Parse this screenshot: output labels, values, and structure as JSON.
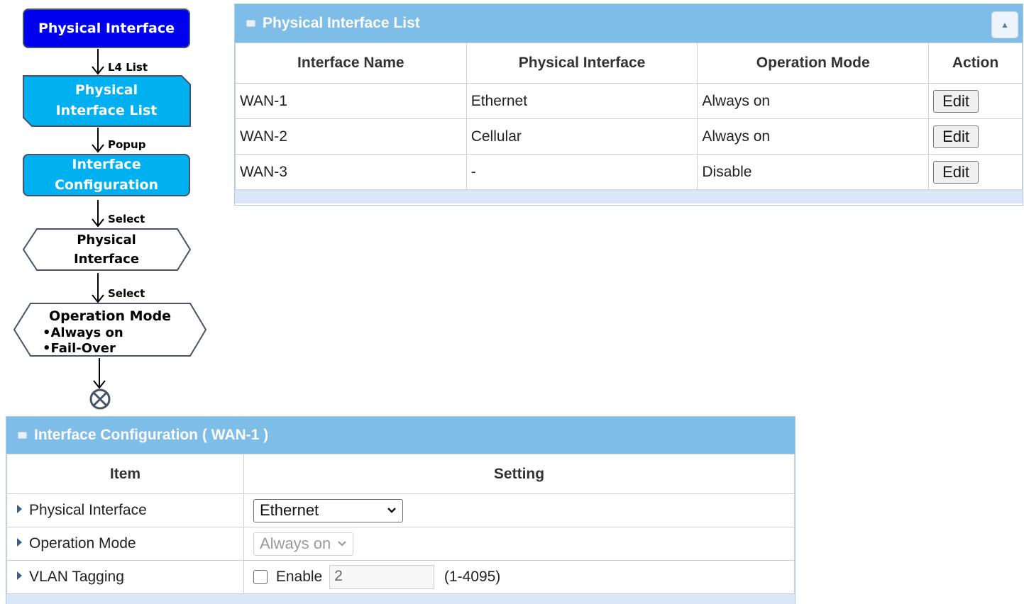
{
  "flowchart": {
    "step1": "Physical Interface",
    "label1": "L4 List",
    "step2_line1": "Physical",
    "step2_line2": "Interface List",
    "label2": "Popup",
    "step3_line1": "Interface",
    "step3_line2": "Configuration",
    "label3": "Select",
    "step4_line1": "Physical",
    "step4_line2": "Interface",
    "label4": "Select",
    "step5_title": "Operation Mode",
    "step5_opt1": "•Always on",
    "step5_opt2": "•Fail-Over",
    "colors": {
      "dark": "#0000ee",
      "light": "#00b0f0",
      "border": "#44546a"
    }
  },
  "interface_list": {
    "title": "Physical Interface List",
    "columns": [
      "Interface Name",
      "Physical Interface",
      "Operation Mode",
      "Action"
    ],
    "rows": [
      {
        "name": "WAN-1",
        "physical": "Ethernet",
        "mode": "Always on",
        "action": "Edit"
      },
      {
        "name": "WAN-2",
        "physical": "Cellular",
        "mode": "Always on",
        "action": "Edit"
      },
      {
        "name": "WAN-3",
        "physical": "-",
        "mode": "Disable",
        "action": "Edit"
      }
    ],
    "collapse_icon": "caret-up-icon"
  },
  "config": {
    "title": "Interface Configuration ( WAN-1 )",
    "col_item": "Item",
    "col_setting": "Setting",
    "physical_label": "Physical Interface",
    "physical_value": "Ethernet",
    "mode_label": "Operation Mode",
    "mode_value": "Always on",
    "vlan_label": "VLAN Tagging",
    "vlan_enable_label": "Enable",
    "vlan_value": "2",
    "vlan_range": "(1-4095)",
    "vlan_enabled": false
  },
  "accent": {
    "header": "#7fbde9",
    "footer": "#dbe7f7"
  }
}
